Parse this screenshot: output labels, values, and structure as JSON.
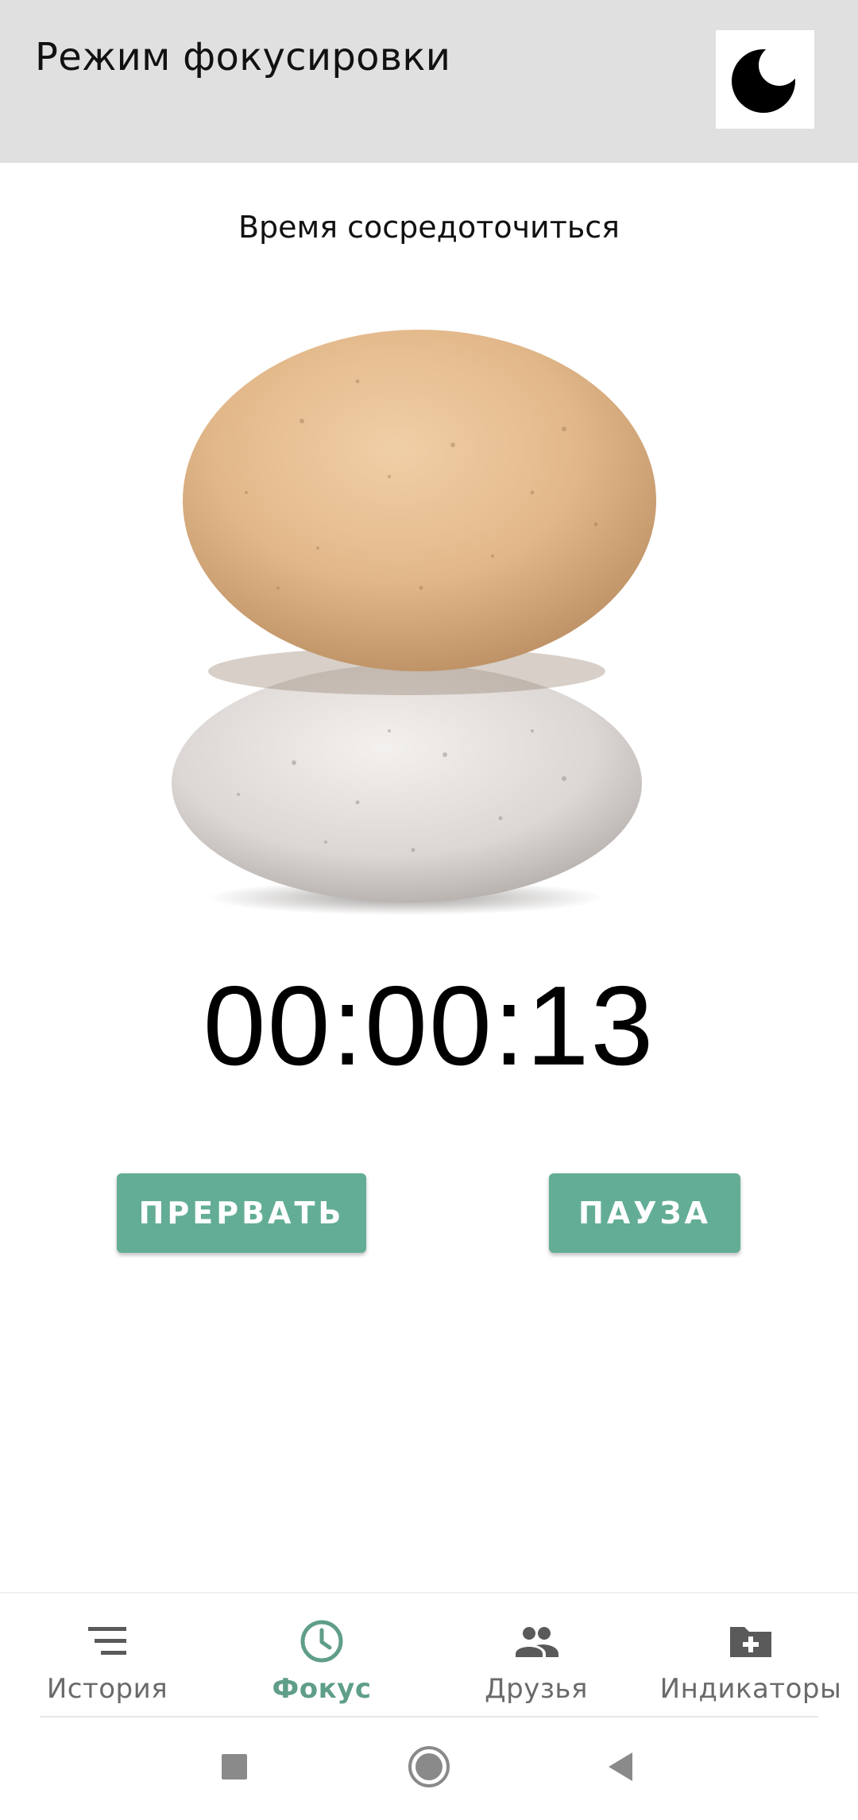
{
  "app_bar": {
    "title": "Режим фокусировки",
    "theme_toggle_icon": "moon-icon",
    "background": "#e0e0e0"
  },
  "main": {
    "subtitle": "Время сосредоточиться",
    "illustration": "stacked-stones",
    "timer": "00:00:13",
    "buttons": {
      "abort_label": "ПРЕРВАТЬ",
      "pause_label": "ПАУЗА"
    },
    "accent_color": "#63ad96"
  },
  "bottom_nav": {
    "items": [
      {
        "label": "История",
        "icon": "list-icon",
        "active": false
      },
      {
        "label": "Фокус",
        "icon": "clock-icon",
        "active": true
      },
      {
        "label": "Друзья",
        "icon": "people-icon",
        "active": false
      },
      {
        "label": "Индикаторы",
        "icon": "folder-add-icon",
        "active": false
      }
    ],
    "active_color": "#5f9e88",
    "inactive_color": "#6a6a6a"
  },
  "system_nav": {
    "buttons": [
      "recents-square-icon",
      "home-circle-icon",
      "back-triangle-icon"
    ]
  }
}
